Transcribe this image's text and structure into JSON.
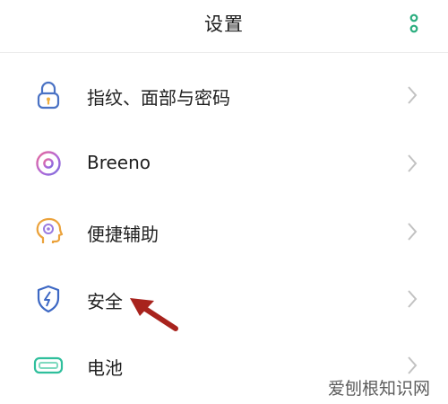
{
  "header": {
    "title": "设置",
    "more_icon": "more-vertical-icon"
  },
  "settings": {
    "items": [
      {
        "label": "指纹、面部与密码",
        "icon": "lock-icon",
        "icon_color": "#4a72c4"
      },
      {
        "label": "Breeno",
        "icon": "breeno-ring-icon",
        "icon_color": "#9a62d8"
      },
      {
        "label": "便捷辅助",
        "icon": "assist-head-icon",
        "icon_color": "#eba23b"
      },
      {
        "label": "安全",
        "icon": "shield-bolt-icon",
        "icon_color": "#3d68c4"
      },
      {
        "label": "电池",
        "icon": "battery-icon",
        "icon_color": "#2fbf9c"
      }
    ]
  },
  "annotation": {
    "arrow_icon": "red-pointer-arrow-icon",
    "arrow_color": "#a8231d"
  },
  "watermark": {
    "text": "爱刨根知识网"
  },
  "colors": {
    "accent": "#2aad7e",
    "chevron": "#c2c2c2"
  }
}
